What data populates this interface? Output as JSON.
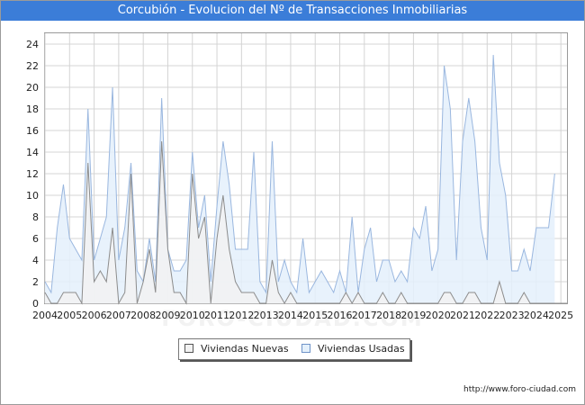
{
  "chart_data": {
    "type": "area",
    "title": "Corcubión - Evolucion del Nº de Transacciones Inmobiliarias",
    "x_tick_labels": [
      "2004",
      "2005",
      "2006",
      "2007",
      "2008",
      "2009",
      "2010",
      "2011",
      "2012",
      "2013",
      "2014",
      "2015",
      "2016",
      "2017",
      "2018",
      "2019",
      "2020",
      "2021",
      "2022",
      "2023",
      "2024",
      "2025"
    ],
    "y_ticks": [
      0,
      2,
      4,
      6,
      8,
      10,
      12,
      14,
      16,
      18,
      20,
      22,
      24
    ],
    "ylim": [
      0,
      25
    ],
    "xlim": [
      2004,
      2025.25
    ],
    "grid": true,
    "legend_position": "bottom-center",
    "quarter_x": [
      2004,
      2004.25,
      2004.5,
      2004.75,
      2005,
      2005.25,
      2005.5,
      2005.75,
      2006,
      2006.25,
      2006.5,
      2006.75,
      2007,
      2007.25,
      2007.5,
      2007.75,
      2008,
      2008.25,
      2008.5,
      2008.75,
      2009,
      2009.25,
      2009.5,
      2009.75,
      2010,
      2010.25,
      2010.5,
      2010.75,
      2011,
      2011.25,
      2011.5,
      2011.75,
      2012,
      2012.25,
      2012.5,
      2012.75,
      2013,
      2013.25,
      2013.5,
      2013.75,
      2014,
      2014.25,
      2014.5,
      2014.75,
      2015,
      2015.25,
      2015.5,
      2015.75,
      2016,
      2016.25,
      2016.5,
      2016.75,
      2017,
      2017.25,
      2017.5,
      2017.75,
      2018,
      2018.25,
      2018.5,
      2018.75,
      2019,
      2019.25,
      2019.5,
      2019.75,
      2020,
      2020.25,
      2020.5,
      2020.75,
      2021,
      2021.25,
      2021.5,
      2021.75,
      2022,
      2022.25,
      2022.5,
      2022.75,
      2023,
      2023.25,
      2023.5,
      2023.75,
      2024,
      2024.25,
      2024.5,
      2024.75,
      2025,
      2025.25
    ],
    "series": [
      {
        "name": "Viviendas Nuevas",
        "color": "#8c8c8c",
        "fill": "#f2f2f2",
        "values": [
          1,
          0,
          0,
          1,
          1,
          1,
          0,
          13,
          2,
          3,
          2,
          7,
          0,
          1,
          12,
          0,
          2,
          5,
          1,
          15,
          5,
          1,
          1,
          0,
          12,
          6,
          8,
          0,
          6,
          10,
          5,
          2,
          1,
          1,
          1,
          0,
          0,
          4,
          1,
          0,
          1,
          0,
          0,
          0,
          0,
          0,
          0,
          0,
          0,
          1,
          0,
          1,
          0,
          0,
          0,
          1,
          0,
          0,
          1,
          0,
          0,
          0,
          0,
          0,
          0,
          1,
          1,
          0,
          0,
          1,
          1,
          0,
          0,
          0,
          2,
          0,
          0,
          0,
          1,
          0,
          0,
          0,
          0,
          0,
          0,
          0
        ]
      },
      {
        "name": "Viviendas Usadas",
        "color": "#9ab7df",
        "fill": "#e4f0fb",
        "values": [
          2,
          1,
          7,
          11,
          6,
          5,
          4,
          18,
          4,
          6,
          8,
          20,
          4,
          7,
          13,
          3,
          2,
          6,
          2,
          19,
          5,
          3,
          3,
          4,
          14,
          7,
          10,
          2,
          9,
          15,
          11,
          5,
          5,
          5,
          14,
          2,
          1,
          15,
          2,
          4,
          2,
          1,
          6,
          1,
          2,
          3,
          2,
          1,
          3,
          1,
          8,
          1,
          5,
          7,
          2,
          4,
          4,
          2,
          3,
          2,
          7,
          6,
          9,
          3,
          5,
          22,
          18,
          4,
          15,
          19,
          15,
          7,
          4,
          23,
          13,
          10,
          3,
          3,
          5,
          3,
          7,
          7,
          7,
          12
        ]
      }
    ]
  },
  "legend": {
    "items": [
      {
        "label": "Viviendas Nuevas",
        "swatch_fill": "#f2f2f2",
        "swatch_border": "#555555"
      },
      {
        "label": "Viviendas Usadas",
        "swatch_fill": "#e4f0fb",
        "swatch_border": "#6f93c8"
      }
    ]
  },
  "watermark": "FORO-CIUDAD.COM",
  "footer": {
    "url": "http://www.foro-ciudad.com"
  }
}
